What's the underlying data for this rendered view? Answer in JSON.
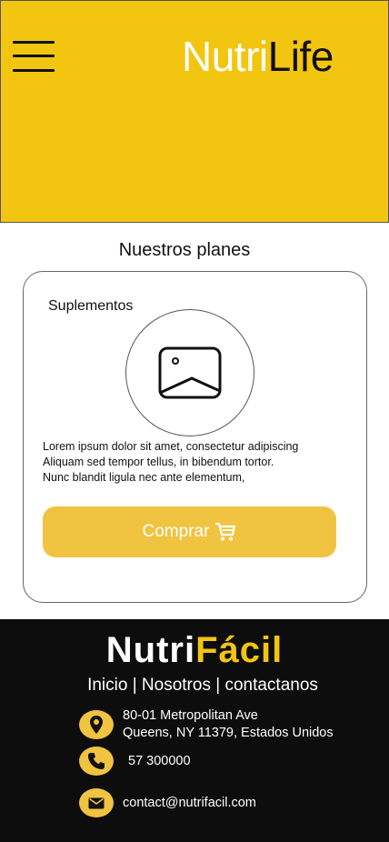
{
  "header": {
    "brand_part1": "Nutri",
    "brand_part2": "Life",
    "menu_icon": "hamburger-icon",
    "background": "#f2c511"
  },
  "plans": {
    "title": "Nuestros planes",
    "card": {
      "title": "Suplementos",
      "image_icon": "image-placeholder-icon",
      "description_lines": [
        "Lorem ipsum dolor sit amet, consectetur adipiscing",
        "Aliquam sed tempor tellus, in bibendum tortor.",
        "Nunc blandit ligula nec ante elementum,"
      ],
      "button_label": "Comprar",
      "button_icon": "shopping-cart-icon",
      "button_color": "#f0c340"
    }
  },
  "footer": {
    "logo_part1": "Nutri",
    "logo_part2": "Fácil",
    "nav": [
      "Inicio",
      "Nosotros",
      "contactanos"
    ],
    "nav_separator": "|",
    "address_line1": "80-01 Metropolitan Ave",
    "address_line2": "Queens, NY 11379, Estados Unidos",
    "phone": "57 300000",
    "email": "contact@nutrifacil.com",
    "icons": [
      "location-pin-icon",
      "phone-icon",
      "email-icon"
    ],
    "accent": "#f0c340",
    "background": "#0d0d0d"
  }
}
